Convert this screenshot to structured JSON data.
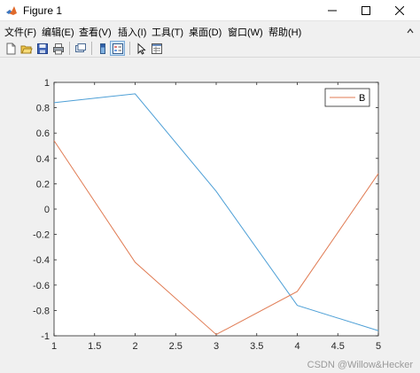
{
  "window": {
    "title": "Figure 1"
  },
  "menu": [
    "文件(F)",
    "编辑(E)",
    "查看(V)",
    "插入(I)",
    "工具(T)",
    "桌面(D)",
    "窗口(W)",
    "帮助(H)"
  ],
  "toolbar": [
    "new-figure-icon",
    "open-file-icon",
    "save-icon",
    "print-icon",
    "link-plot-icon",
    "colorbar-icon",
    "legend-icon",
    "pointer-icon",
    "property-editor-icon"
  ],
  "colors": {
    "series_A": "#4d9fd6",
    "series_B": "#e07b53"
  },
  "chart_data": {
    "type": "line",
    "title": "",
    "xlabel": "",
    "ylabel": "",
    "xlim": [
      1,
      5
    ],
    "ylim": [
      -1,
      1
    ],
    "xticks": [
      "1",
      "1.5",
      "2",
      "2.5",
      "3",
      "3.5",
      "4",
      "4.5",
      "5"
    ],
    "yticks": [
      "1",
      "0.8",
      "0.6",
      "0.4",
      "0.2",
      "0",
      "-0.2",
      "-0.4",
      "-0.6",
      "-0.8",
      "-1"
    ],
    "grid": false,
    "legend": {
      "position": "top-right",
      "entries": [
        "B"
      ]
    },
    "x": [
      1,
      2,
      3,
      4,
      5
    ],
    "series": [
      {
        "values": [
          0.84,
          0.91,
          0.14,
          -0.76,
          -0.96
        ]
      },
      {
        "name": "B",
        "values": [
          0.54,
          -0.42,
          -0.99,
          -0.65,
          0.28
        ]
      }
    ]
  },
  "watermark": "CSDN @Willow&Hecker"
}
